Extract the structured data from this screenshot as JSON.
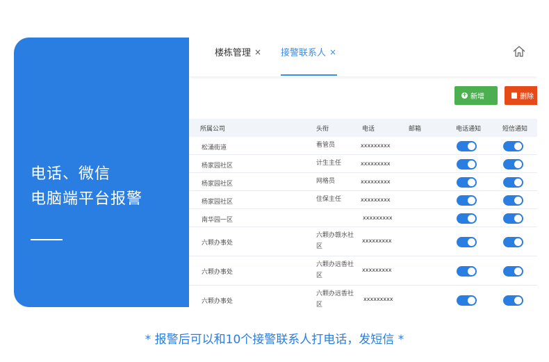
{
  "hero": {
    "line1": "电话、微信",
    "line2": "电脑端平台报警"
  },
  "tabs": [
    {
      "label": "楼栋管理",
      "close": "×",
      "active": false
    },
    {
      "label": "接警联系人",
      "close": "×",
      "active": true
    }
  ],
  "toolbar": {
    "add_label": "新增",
    "delete_label": "删除"
  },
  "table": {
    "columns": [
      "所属公司",
      "头衔",
      "电话",
      "邮箱",
      "电话通知",
      "短信通知"
    ],
    "rows": [
      {
        "company": "松涌街道",
        "title": "看管员",
        "phone": "xxxxxxxxx",
        "email": "",
        "call_notify": true,
        "sms_notify": true
      },
      {
        "company": "杨家园社区",
        "title": "计生主任",
        "phone": "xxxxxxxxx",
        "email": "",
        "call_notify": true,
        "sms_notify": true
      },
      {
        "company": "杨家园社区",
        "title": "网格员",
        "phone": "xxxxxxxxx",
        "email": "",
        "call_notify": true,
        "sms_notify": true
      },
      {
        "company": "杨家园社区",
        "title": "住保主任",
        "phone": "xxxxxxxxx",
        "email": "",
        "call_notify": true,
        "sms_notify": true
      },
      {
        "company": "南华园一区",
        "title": "",
        "phone": "xxxxxxxxx",
        "email": "",
        "call_notify": true,
        "sms_notify": true
      },
      {
        "company": "六颗办事处",
        "title": "六颗办赣水社区",
        "phone": "xxxxxxxxx",
        "email": "",
        "call_notify": true,
        "sms_notify": true
      },
      {
        "company": "六颗办事处",
        "title": "六颗办远香社区",
        "phone": "xxxxxxxxx",
        "email": "",
        "call_notify": true,
        "sms_notify": true
      },
      {
        "company": "六颗办事处",
        "title": "六颗办远香社区",
        "phone": "xxxxxxxxx",
        "email": "",
        "call_notify": true,
        "sms_notify": true
      }
    ]
  },
  "footer": "* 报警后可以和10个接警联系人打电话，发短信 *",
  "colors": {
    "primary": "#2a7de1",
    "add": "#4caf50",
    "delete": "#e64a19"
  },
  "icons": {
    "home": "home-icon",
    "add": "plus-circle-icon",
    "delete": "trash-icon"
  }
}
